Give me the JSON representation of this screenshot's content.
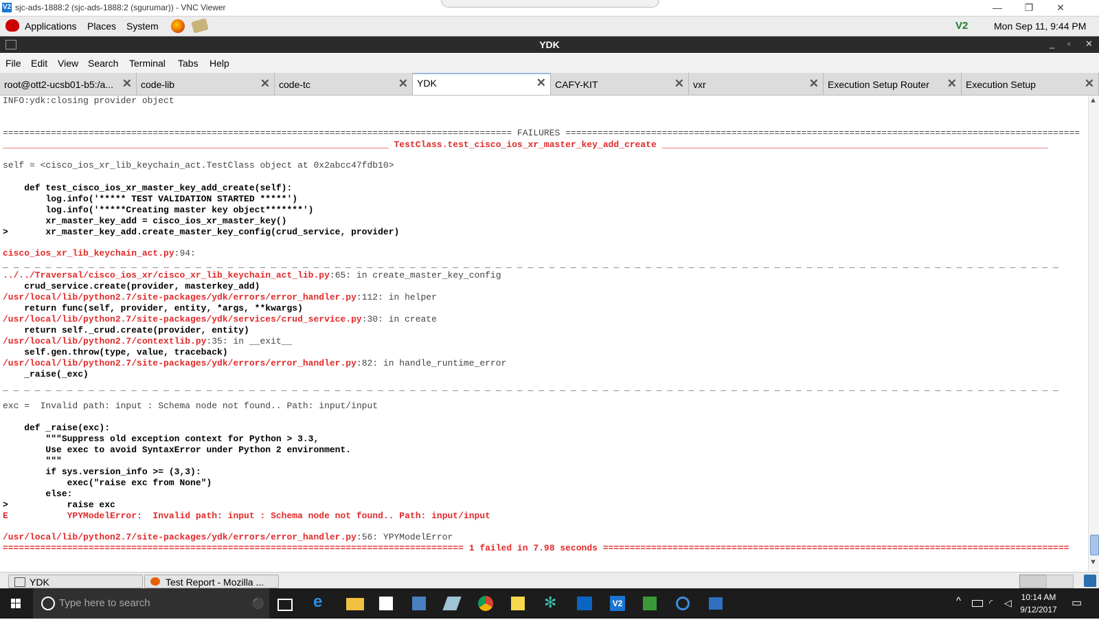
{
  "vnc": {
    "title": "sjc-ads-1888:2 (sjc-ads-1888:2 (sgurumar)) - VNC Viewer",
    "logo": "V2",
    "minimize": "—",
    "restore": "❐",
    "close": "✕"
  },
  "gnome_panel": {
    "menus": [
      "Applications",
      "Places",
      "System"
    ],
    "ve_indicator": "V2",
    "datetime": "Mon Sep 11,  9:44 PM"
  },
  "terminal_window": {
    "title": "YDK",
    "min": "_",
    "max": "▫",
    "close": "✕"
  },
  "menubar": [
    "File",
    "Edit",
    "View",
    "Search",
    "Terminal",
    "Tabs",
    "Help"
  ],
  "tabs": [
    {
      "label": "root@ott2-ucsb01-b5:/a..."
    },
    {
      "label": "code-lib"
    },
    {
      "label": "code-tc"
    },
    {
      "label": "YDK"
    },
    {
      "label": "CAFY-KIT"
    },
    {
      "label": "vxr"
    },
    {
      "label": "Execution Setup Router"
    },
    {
      "label": "Execution Setup"
    }
  ],
  "terminal_lines": [
    {
      "text": "INFO:ydk:closing provider object",
      "style": "n"
    },
    {
      "text": "=============================================================================================== FAILURES ================================================================================================",
      "style": "n"
    },
    {
      "text": "________________________________________________________________________ TestClass.test_cisco_ios_xr_master_key_add_create ________________________________________________________________________",
      "style": "rb"
    },
    {
      "text": "self = <cisco_ios_xr_lib_keychain_act.TestClass object at 0x2abcc47fdb10>",
      "style": "n"
    },
    {
      "text": "    def test_cisco_ios_xr_master_key_add_create(self):",
      "style": "b"
    },
    {
      "text": "        log.info('***** TEST VALIDATION STARTED *****')",
      "style": "b"
    },
    {
      "text": "        log.info('*****Creating master key object*******')",
      "style": "b"
    },
    {
      "text": "        xr_master_key_add = cisco_ios_xr_master_key()",
      "style": "b"
    },
    {
      "text": ">       xr_master_key_add.create_master_key_config(crud_service, provider)",
      "style": "b"
    },
    {
      "text": "cisco_ios_xr_lib_keychain_act.py",
      "style": "rb",
      "suffix": ":94:"
    },
    {
      "text": "_ _ _ _ _ _ _ _ _ _ _ _ _ _ _ _ _ _ _ _ _ _ _ _ _ _ _ _ _ _ _ _ _ _ _ _ _ _ _ _ _ _ _ _ _ _ _ _ _ _ _ _ _ _ _ _ _ _ _ _ _ _ _ _ _ _ _ _ _ _ _ _ _ _ _ _ _ _ _ _ _ _ _ _ _ _ _ _ _ _ _ _ _ _ _ _ _ _ _",
      "style": "n"
    },
    {
      "text": "../../Traversal/cisco_ios_xr/cisco_xr_lib_keychain_act_lib.py",
      "style": "rb",
      "suffix": ":65: in create_master_key_config"
    },
    {
      "text": "    crud_service.create(provider, masterkey_add)",
      "style": "b"
    },
    {
      "text": "/usr/local/lib/python2.7/site-packages/ydk/errors/error_handler.py",
      "style": "rb",
      "suffix": ":112: in helper"
    },
    {
      "text": "    return func(self, provider, entity, *args, **kwargs)",
      "style": "b"
    },
    {
      "text": "/usr/local/lib/python2.7/site-packages/ydk/services/crud_service.py",
      "style": "rb",
      "suffix": ":30: in create"
    },
    {
      "text": "    return self._crud.create(provider, entity)",
      "style": "b"
    },
    {
      "text": "/usr/local/lib/python2.7/contextlib.py",
      "style": "rb",
      "suffix": ":35: in __exit__"
    },
    {
      "text": "    self.gen.throw(type, value, traceback)",
      "style": "b"
    },
    {
      "text": "/usr/local/lib/python2.7/site-packages/ydk/errors/error_handler.py",
      "style": "rb",
      "suffix": ":82: in handle_runtime_error"
    },
    {
      "text": "    _raise(_exc)",
      "style": "b"
    },
    {
      "text": "_ _ _ _ _ _ _ _ _ _ _ _ _ _ _ _ _ _ _ _ _ _ _ _ _ _ _ _ _ _ _ _ _ _ _ _ _ _ _ _ _ _ _ _ _ _ _ _ _ _ _ _ _ _ _ _ _ _ _ _ _ _ _ _ _ _ _ _ _ _ _ _ _ _ _ _ _ _ _ _ _ _ _ _ _ _ _ _ _ _ _ _ _ _ _ _ _ _ _",
      "style": "n"
    },
    {
      "text": "exc =  Invalid path: input : Schema node not found.. Path: input/input",
      "style": "n"
    },
    {
      "text": "    def _raise(exc):",
      "style": "b"
    },
    {
      "text": "        \"\"\"Suppress old exception context for Python > 3.3,",
      "style": "b"
    },
    {
      "text": "        Use exec to avoid SyntaxError under Python 2 environment.",
      "style": "b"
    },
    {
      "text": "        \"\"\"",
      "style": "b"
    },
    {
      "text": "        if sys.version_info >= (3,3):",
      "style": "b"
    },
    {
      "text": "            exec(\"raise exc from None\")",
      "style": "b"
    },
    {
      "text": "        else:",
      "style": "b"
    },
    {
      "text": ">           raise exc",
      "style": "b"
    },
    {
      "text": "E           YPYModelError:  Invalid path: input : Schema node not found.. Path: input/input",
      "style": "rb"
    },
    {
      "text": "/usr/local/lib/python2.7/site-packages/ydk/errors/error_handler.py",
      "style": "rb",
      "suffix": ":56: YPYModelError"
    },
    {
      "text": "====================================================================================== 1 failed in 7.98 seconds =======================================================================================",
      "style": "rb"
    }
  ],
  "bottom_panel": {
    "tasks": [
      {
        "label": "YDK"
      },
      {
        "label": "Test Report - Mozilla ..."
      }
    ]
  },
  "windows": {
    "search_placeholder": "Type here to search",
    "mic": "🎤",
    "clock_time": "10:14 AM",
    "clock_date": "9/12/2017",
    "tray_up": "^",
    "notify": "▭"
  }
}
